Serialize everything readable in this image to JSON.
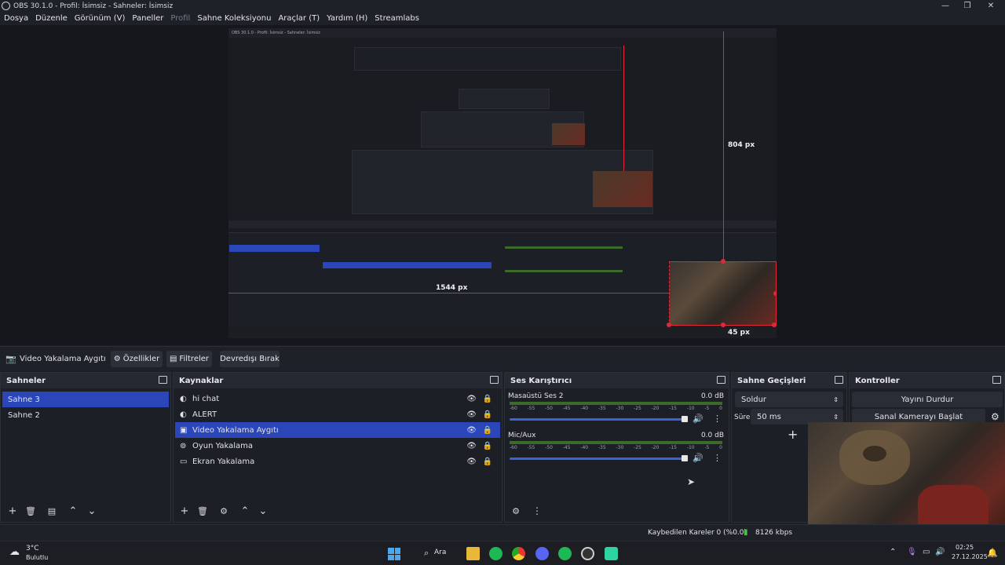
{
  "window": {
    "title": "OBS 30.1.0 - Profil: İsimsiz - Sahneler: İsimsiz"
  },
  "menu": [
    {
      "label": "Dosya",
      "enabled": true
    },
    {
      "label": "Düzenle",
      "enabled": true
    },
    {
      "label": "Görünüm (V)",
      "enabled": true
    },
    {
      "label": "Paneller",
      "enabled": true
    },
    {
      "label": "Profil",
      "enabled": false
    },
    {
      "label": "Sahne Koleksiyonu",
      "enabled": true
    },
    {
      "label": "Araçlar (T)",
      "enabled": true
    },
    {
      "label": "Yardım (H)",
      "enabled": true
    },
    {
      "label": "Streamlabs",
      "enabled": true
    }
  ],
  "preview": {
    "measure_vertical": "804 px",
    "measure_horizontal": "1544 px",
    "measure_small": "45 px",
    "nested_title": "OBS 30.1.0 - Profil: İsimsiz - Sahneler: İsimsiz"
  },
  "source_toolbar": {
    "selected_source": "Video Yakalama Aygıtı",
    "properties": "Özellikler",
    "filters": "Filtreler",
    "deactivate": "Devredışı Bırak"
  },
  "scenes": {
    "title": "Sahneler",
    "items": [
      "Sahne 3",
      "Sahne 2"
    ],
    "selected": 0
  },
  "sources": {
    "title": "Kaynaklar",
    "items": [
      {
        "label": "hi chat",
        "icon": "browser-icon"
      },
      {
        "label": "ALERT",
        "icon": "browser-icon"
      },
      {
        "label": "Video Yakalama Aygıtı",
        "icon": "camera-icon"
      },
      {
        "label": "Oyun Yakalama",
        "icon": "gamepad-icon"
      },
      {
        "label": "Ekran Yakalama",
        "icon": "monitor-icon"
      }
    ],
    "selected": 2
  },
  "mixer": {
    "title": "Ses Karıştırıcı",
    "channels": [
      {
        "name": "Masaüstü Ses 2",
        "level": "0.0 dB"
      },
      {
        "name": "Mic/Aux",
        "level": "0.0 dB"
      }
    ],
    "scale": [
      "-60",
      "-55",
      "-50",
      "-45",
      "-40",
      "-35",
      "-30",
      "-25",
      "-20",
      "-15",
      "-10",
      "-5",
      "0"
    ]
  },
  "transitions": {
    "title": "Sahne Geçişleri",
    "type": "Soldur",
    "duration_label": "Süre",
    "duration": "50 ms"
  },
  "controls": {
    "title": "Kontroller",
    "stop_stream": "Yayını Durdur",
    "virtual_cam": "Sanal Kamerayı Başlat"
  },
  "status": {
    "dropped": "Kaybedilen Kareler 0 (%0.0)",
    "bitrate": "8126 kbps"
  },
  "taskbar": {
    "weather_temp": "3°C",
    "weather_desc": "Bulutlu",
    "search": "Ara",
    "time": "02:25",
    "date": "27.12.2025"
  },
  "colors": {
    "accent": "#2a46b8",
    "measure": "#e0283a"
  }
}
